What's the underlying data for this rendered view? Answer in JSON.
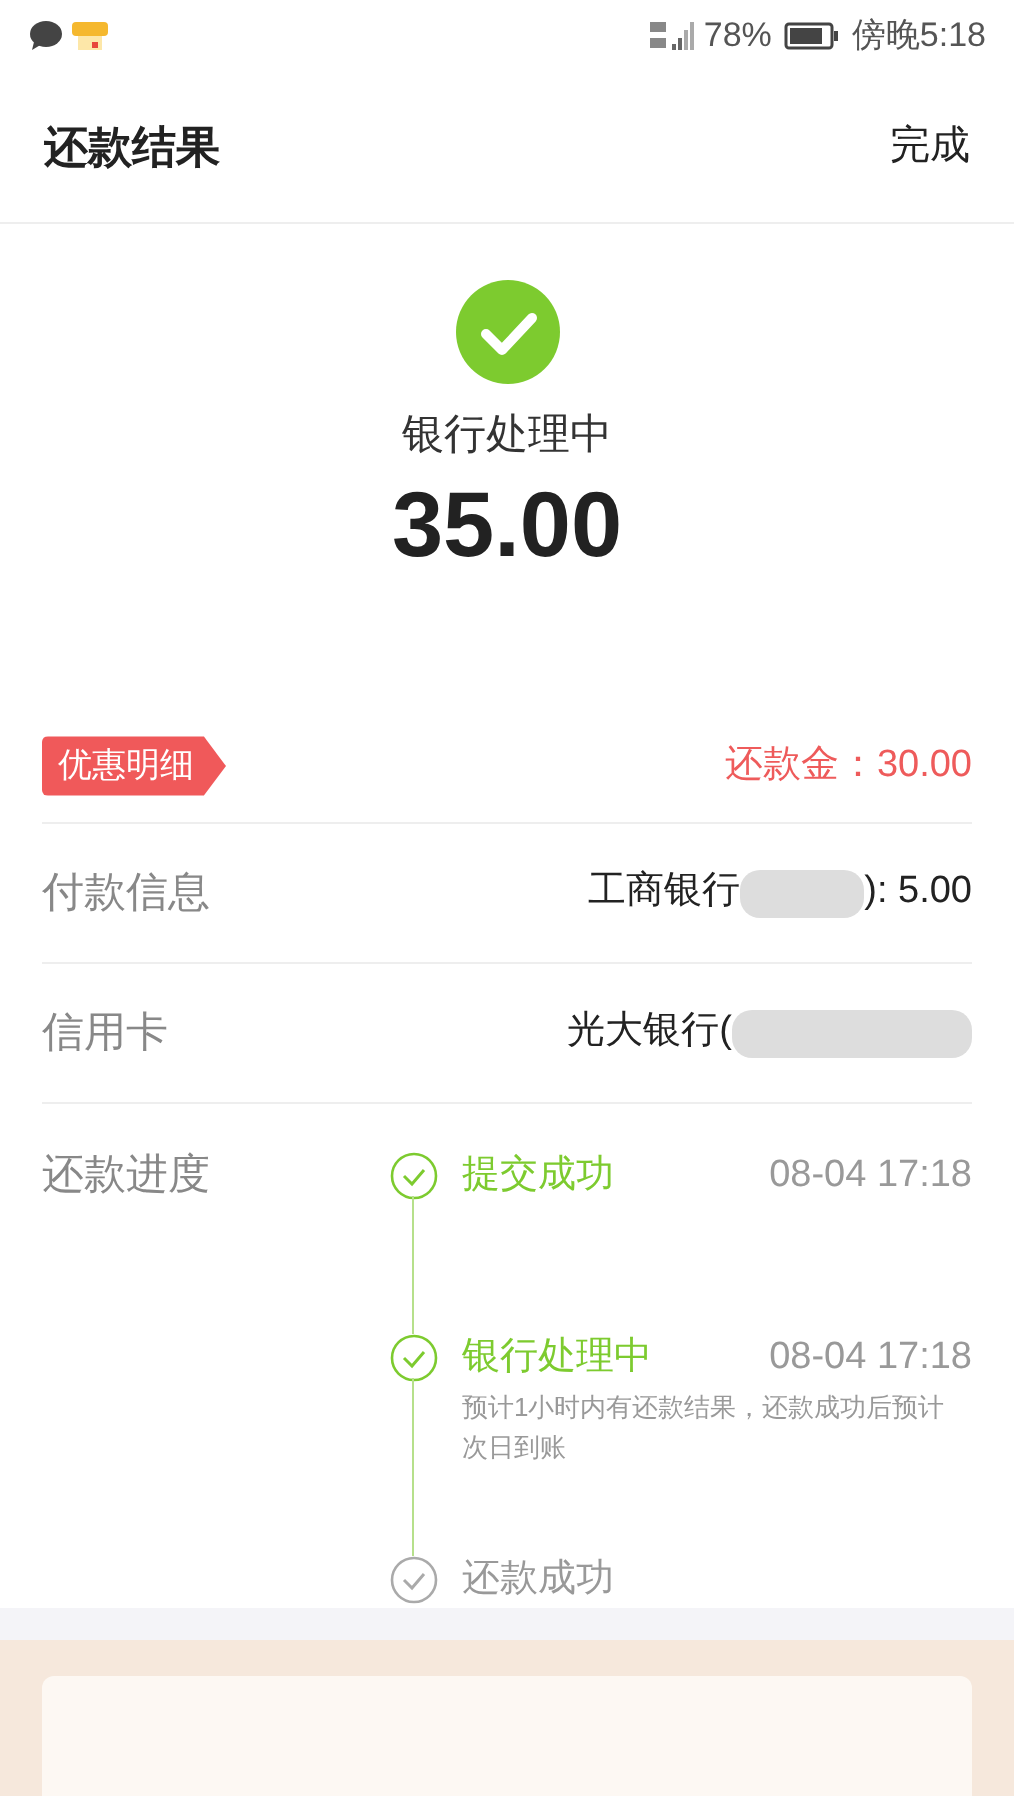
{
  "status_bar": {
    "battery": "78%",
    "time": "傍晚5:18"
  },
  "header": {
    "title": "还款结果",
    "action": "完成"
  },
  "result": {
    "status": "银行处理中",
    "amount": "35.00"
  },
  "discount": {
    "tag": "优惠明细",
    "reward": "还款金：30.00"
  },
  "rows": [
    {
      "label": "付款信息",
      "value_start": "工商银行",
      "value_end": "): 5.00"
    },
    {
      "label": "信用卡",
      "value_start": "光大银行(",
      "value_end": ""
    }
  ],
  "progress": {
    "label": "还款进度",
    "steps": [
      {
        "title": "提交成功",
        "time": "08-04 17:18",
        "done": true
      },
      {
        "title": "银行处理中",
        "time": "08-04 17:18",
        "note": "预计1小时内有还款结果，还款成功后预计次日到账",
        "done": true
      },
      {
        "title": "还款成功",
        "done": false
      }
    ]
  }
}
